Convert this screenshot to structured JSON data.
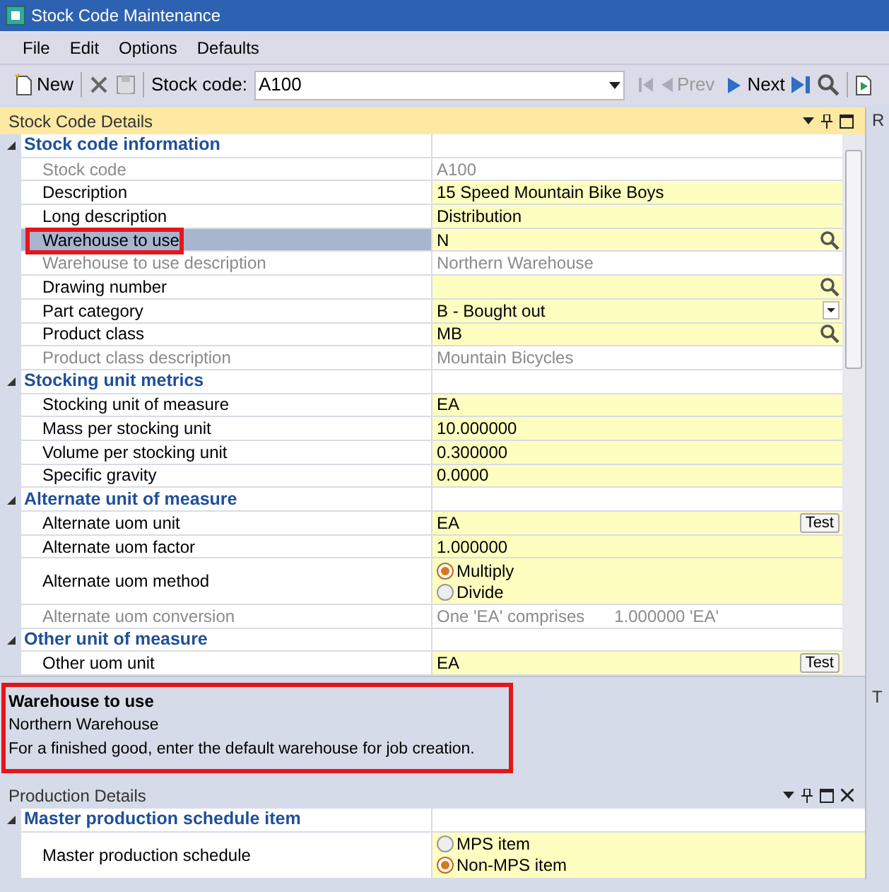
{
  "window": {
    "title": "Stock Code Maintenance"
  },
  "menu": [
    "File",
    "Edit",
    "Options",
    "Defaults"
  ],
  "toolbar": {
    "new_label": "New",
    "stock_code_label": "Stock code:",
    "stock_code_value": "A100",
    "prev_label": "Prev",
    "next_label": "Next"
  },
  "details_panel": {
    "title": "Stock Code Details",
    "sections": [
      {
        "title": "Stock code information",
        "expanded": true,
        "rows": [
          {
            "label": "Stock code",
            "value": "A100",
            "kind": "readonly",
            "selected": false
          },
          {
            "label": "Description",
            "value": "15 Speed Mountain Bike Boys",
            "kind": "text",
            "selected": false
          },
          {
            "label": "Long description",
            "value": "Distribution",
            "kind": "text",
            "selected": false
          },
          {
            "label": "Warehouse to use",
            "value": "N",
            "kind": "lookup",
            "selected": true
          },
          {
            "label": "Warehouse to use description",
            "value": "Northern Warehouse",
            "kind": "readonly",
            "selected": false
          },
          {
            "label": "Drawing number",
            "kind": "lookup",
            "selected": false
          },
          {
            "label": "Part category",
            "value": "B - Bought out",
            "kind": "dropdown",
            "selected": false
          },
          {
            "label": "Product class",
            "value": "MB",
            "kind": "lookup",
            "selected": false
          },
          {
            "label": "Product class description",
            "value": "Mountain Bicycles",
            "kind": "readonly",
            "selected": false
          }
        ]
      },
      {
        "title": "Stocking unit metrics",
        "expanded": true,
        "rows": [
          {
            "label": "Stocking unit of measure",
            "value": "EA",
            "kind": "text",
            "selected": false
          },
          {
            "label": "Mass per stocking unit",
            "value": "10.000000",
            "kind": "text",
            "selected": false
          },
          {
            "label": "Volume per stocking unit",
            "value": "0.300000",
            "kind": "text",
            "selected": false
          },
          {
            "label": "Specific gravity",
            "value": "0.0000",
            "kind": "text",
            "selected": false
          }
        ]
      },
      {
        "title": "Alternate unit of measure",
        "expanded": true,
        "rows": [
          {
            "label": "Alternate uom unit",
            "value": "EA",
            "kind": "test",
            "button": "Test",
            "selected": false
          },
          {
            "label": "Alternate uom factor",
            "value": "1.000000",
            "kind": "text",
            "selected": false
          },
          {
            "label": "Alternate uom method",
            "kind": "radio",
            "selected": false,
            "options": [
              {
                "label": "Multiply",
                "selected": true
              },
              {
                "label": "Divide",
                "selected": false
              }
            ]
          },
          {
            "label": "Alternate uom conversion",
            "value": "One 'EA' comprises",
            "value_2": "1.000000 'EA'",
            "kind": "readonly",
            "selected": false
          }
        ]
      },
      {
        "title": "Other unit of measure",
        "expanded": true,
        "rows": [
          {
            "label": "Other uom unit",
            "value": "EA",
            "kind": "test",
            "button": "Test",
            "selected": false
          }
        ]
      }
    ]
  },
  "help_box": {
    "title": "Warehouse to use",
    "lines": [
      "Northern Warehouse",
      "For a finished good, enter the default warehouse for job creation."
    ]
  },
  "production_panel": {
    "title": "Production Details",
    "sections": [
      {
        "title": "Master production schedule item",
        "expanded": true,
        "rows": [
          {
            "label": "Master production schedule",
            "kind": "radio",
            "selected": false,
            "options": [
              {
                "label": "MPS item",
                "selected": false
              },
              {
                "label": "Non-MPS item",
                "selected": true
              }
            ]
          }
        ]
      }
    ]
  },
  "side_panels": [
    "R",
    "T"
  ]
}
